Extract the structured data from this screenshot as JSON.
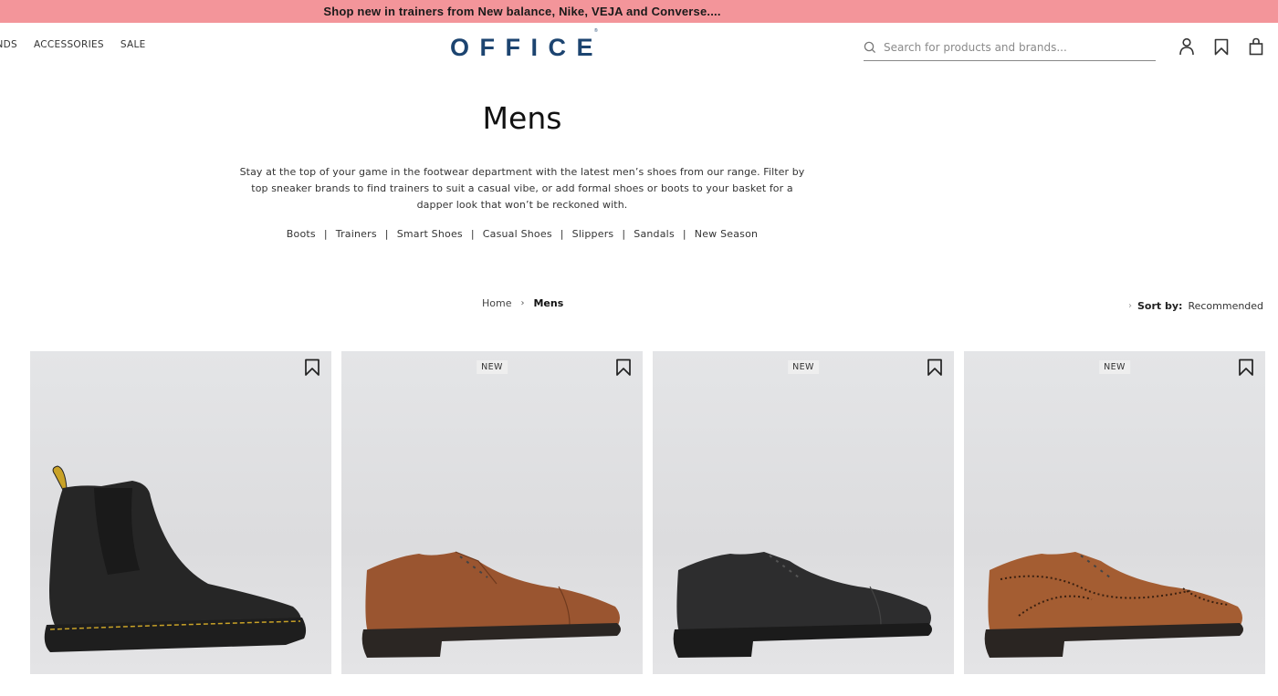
{
  "promo_banner": {
    "text": "Shop new in trainers from New balance, Nike, VEJA and Converse...."
  },
  "header": {
    "nav": [
      "BRANDS",
      "ACCESSORIES",
      "SALE"
    ],
    "nav_visible_first": "ANDS",
    "logo": "OFFICE",
    "search": {
      "placeholder": "Search for products and brands...",
      "value": "",
      "icon": "search-icon"
    },
    "icons": [
      "account-icon",
      "wishlist-icon",
      "basket-icon"
    ]
  },
  "category": {
    "title": "Mens",
    "description": "Stay at the top of your game in the footwear department with the latest men’s shoes from our range. Filter by top sneaker brands to find trainers to suit a casual vibe, or add formal shoes or boots to your basket for a dapper look that won’t be reckoned with.",
    "links": [
      "Boots",
      "Trainers",
      "Smart Shoes",
      "Casual Shoes",
      "Slippers",
      "Sandals",
      "New Season"
    ]
  },
  "breadcrumb": {
    "items": [
      "Home",
      "Mens"
    ],
    "separator": "›"
  },
  "sort": {
    "label": "Sort by:",
    "value": "Recommended"
  },
  "products": [
    {
      "badge": "",
      "image": "black chelsea boot with yellow stitching",
      "colors": {
        "upper": "#2a2a2a",
        "sole": "#1d1d1d",
        "stitch": "#c9a227"
      }
    },
    {
      "badge": "NEW",
      "image": "tan leather toe-cap derby shoe",
      "colors": {
        "upper": "#9a5530",
        "sole": "#2b2623",
        "stitch": "#7a4020"
      }
    },
    {
      "badge": "NEW",
      "image": "black leather toe-cap oxford shoe",
      "colors": {
        "upper": "#2d2d2e",
        "sole": "#1b1b1b",
        "stitch": "#444"
      }
    },
    {
      "badge": "NEW",
      "image": "tan leather brogue oxford shoe",
      "colors": {
        "upper": "#a45d32",
        "sole": "#2a2522",
        "stitch": "#3a2010"
      }
    }
  ]
}
